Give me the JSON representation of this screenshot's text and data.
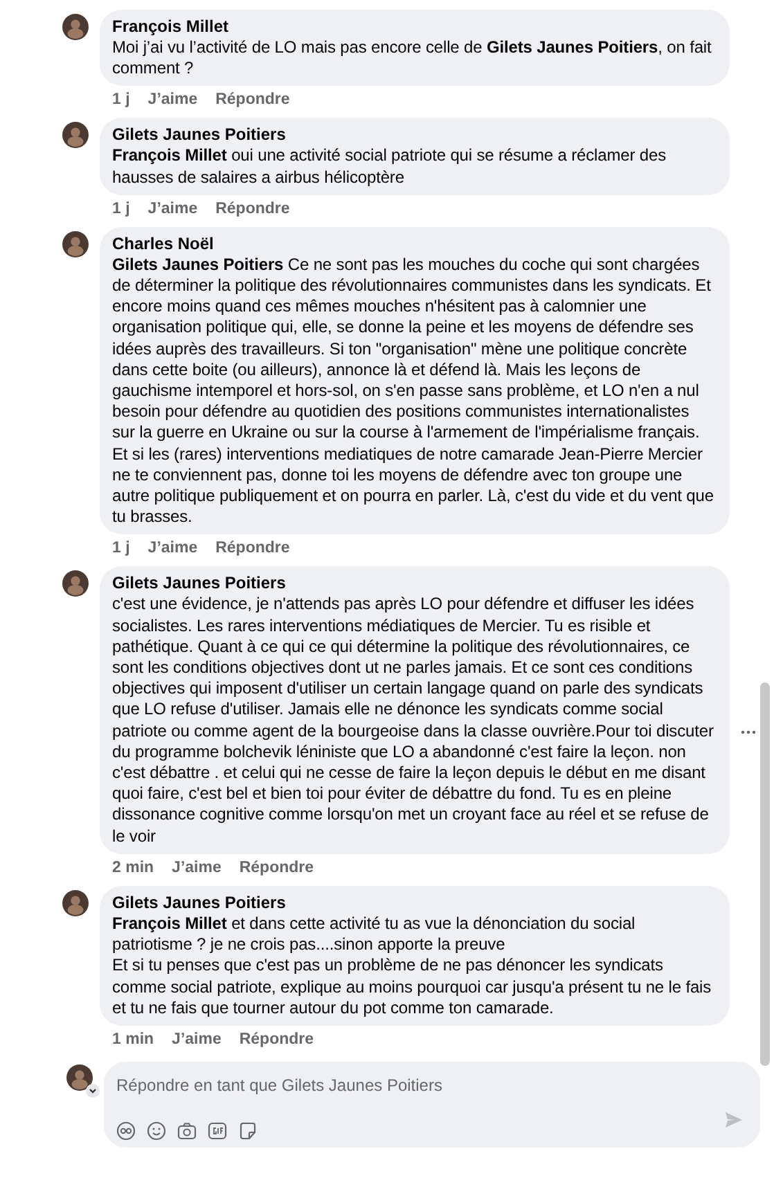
{
  "comments": [
    {
      "author": "François Millet",
      "text": "Moi j’ai vu l’activité de LO mais pas encore celle de **Gilets Jaunes Poitiers**, on fait comment ?",
      "time": "1 j",
      "like": "J’aime",
      "reply": "Répondre"
    },
    {
      "author": "Gilets Jaunes Poitiers",
      "text": "**François Millet** oui une activité social patriote qui se résume a réclamer des hausses de salaires a airbus hélicoptère",
      "time": "1 j",
      "like": "J’aime",
      "reply": "Répondre"
    },
    {
      "author": "Charles Noël",
      "text": "**Gilets Jaunes Poitiers** Ce ne sont pas les mouches du coche qui sont chargées de déterminer la politique des révolutionnaires communistes dans les syndicats. Et encore moins quand ces mêmes mouches n'hésitent pas à calomnier une organisation politique qui, elle, se donne la peine et les moyens de défendre ses idées auprès des travailleurs. Si ton \"organisation\" mène une politique concrète dans cette boite (ou ailleurs), annonce là et défend là. Mais les leçons de gauchisme intemporel et hors-sol, on s'en passe sans problème, et LO n'en a nul besoin pour défendre au quotidien des positions communistes internationalistes sur la guerre en Ukraine ou sur la course à l'armement de l'impérialisme français. Et si les (rares) interventions mediatiques de notre camarade Jean-Pierre Mercier ne te conviennent pas, donne toi les moyens de défendre avec ton groupe une autre politique publiquement et on pourra en parler. Là, c'est du vide et du vent que tu brasses.",
      "time": "1 j",
      "like": "J’aime",
      "reply": "Répondre"
    },
    {
      "author": "Gilets Jaunes Poitiers",
      "text": "c'est une évidence, je n'attends pas après LO pour défendre et diffuser les idées socialistes. Les rares interventions médiatiques de Mercier. Tu es risible et pathétique. Quant à ce qui ce qui détermine la politique des révolutionnaires, ce sont les conditions objectives dont ut ne parles jamais. Et ce sont ces conditions objectives qui imposent d'utiliser un certain langage quand on parle des syndicats que LO refuse d'utiliser. Jamais elle ne dénonce les syndicats comme social patriote ou comme agent de la bourgeoise dans la classe ouvrière.Pour toi discuter du programme bolchevik léniniste que LO a abandonné c'est faire la leçon. non c'est débattre . et celui qui ne cesse de faire la leçon depuis le début en me disant quoi faire, c'est bel et bien toi pour éviter de débattre du fond. Tu es en pleine dissonance cognitive comme lorsqu'on met un croyant face au réel et se refuse de le voir",
      "time": "2 min",
      "like": "J’aime",
      "reply": "Répondre"
    },
    {
      "author": "Gilets Jaunes Poitiers",
      "text": "**François Millet** et dans cette activité tu as vue la dénonciation du social patriotisme ? je ne crois pas....sinon apporte la preuve\nEt si tu penses que c'est pas un problème de ne pas dénoncer les syndicats comme social patriote, explique au moins pourquoi car jusqu'a présent tu ne le fais et tu ne fais que tourner autour du pot comme ton camarade.",
      "time": "1 min",
      "like": "J’aime",
      "reply": "Répondre"
    }
  ],
  "composer": {
    "placeholder": "Répondre en tant que Gilets Jaunes Poitiers"
  }
}
